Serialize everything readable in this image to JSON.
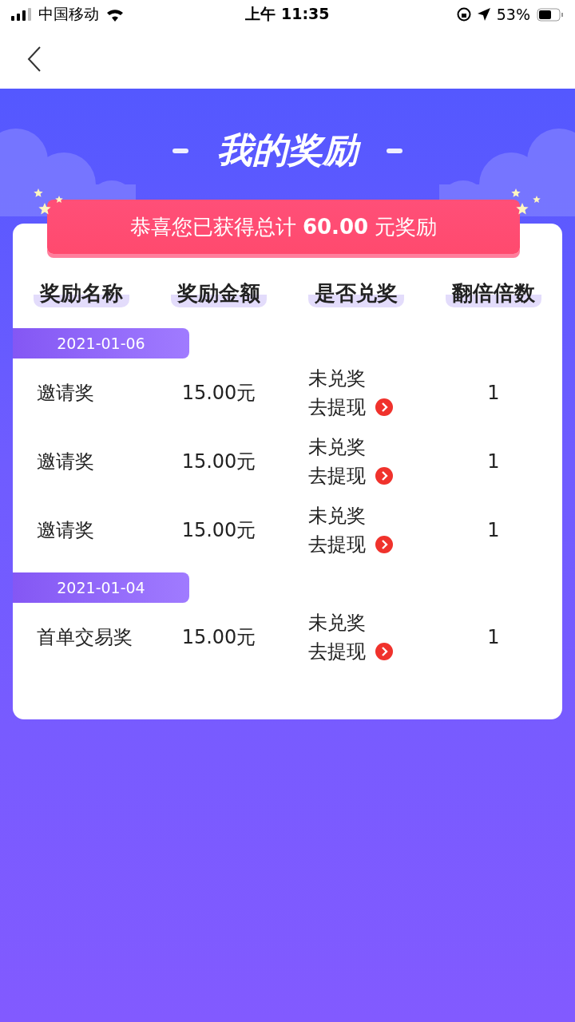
{
  "status_bar": {
    "carrier": "中国移动",
    "time": "上午 11:35",
    "battery": "53%"
  },
  "title": "我的奖励",
  "banner": "恭喜您已获得总计 **60.00** 元奖励",
  "columns": [
    "奖励名称",
    "奖励金额",
    "是否兑奖",
    "翻倍倍数"
  ],
  "groups": [
    {
      "date": "2021-01-06",
      "rows": [
        {
          "name": "邀请奖",
          "amount": "15.00元",
          "status": "未兑奖",
          "action": "去提现",
          "multiplier": "1"
        },
        {
          "name": "邀请奖",
          "amount": "15.00元",
          "status": "未兑奖",
          "action": "去提现",
          "multiplier": "1"
        },
        {
          "name": "邀请奖",
          "amount": "15.00元",
          "status": "未兑奖",
          "action": "去提现",
          "multiplier": "1"
        }
      ]
    },
    {
      "date": "2021-01-04",
      "rows": [
        {
          "name": "首单交易奖",
          "amount": "15.00元",
          "status": "未兑奖",
          "action": "去提现",
          "multiplier": "1"
        }
      ]
    }
  ]
}
